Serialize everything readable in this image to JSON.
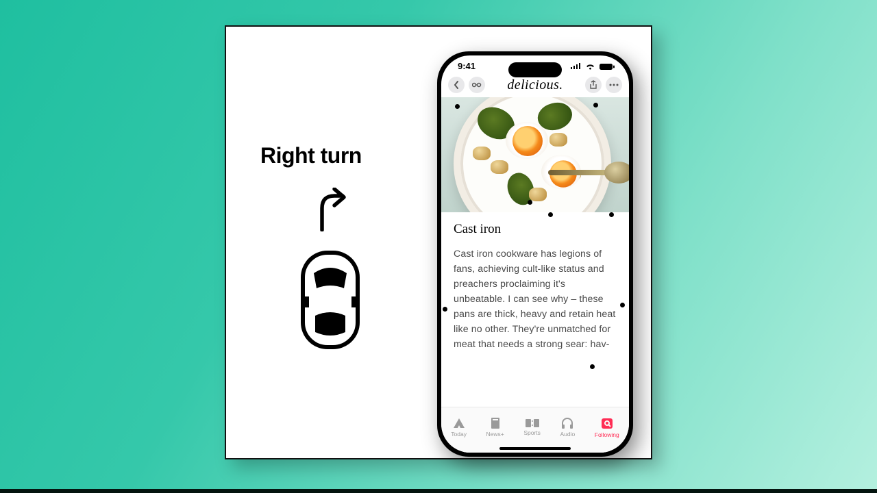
{
  "illustration": {
    "caption": "Right turn",
    "arrow_icon": "right-turn-arrow-icon",
    "car_icon": "car-top-view-icon"
  },
  "phone": {
    "status": {
      "time": "9:41"
    },
    "nav": {
      "back_icon": "chevron-left-icon",
      "reader_icon": "reader-view-icon",
      "brand": "delicious.",
      "share_icon": "share-icon",
      "more_icon": "ellipsis-icon"
    },
    "article": {
      "title": "Cast iron",
      "body": "Cast iron cookware has legions of fans, achieving cult-like status and preachers proclaiming it's unbeatable. I can see why – these pans are thick, heavy and retain heat like no other. They're unmatched for meat that needs a strong sear: hav-"
    },
    "tabs": [
      {
        "label": "Today",
        "icon": "news-today-icon",
        "active": false
      },
      {
        "label": "News+",
        "icon": "news-plus-icon",
        "active": false
      },
      {
        "label": "Sports",
        "icon": "scoreboard-icon",
        "active": false
      },
      {
        "label": "Audio",
        "icon": "headphones-icon",
        "active": false
      },
      {
        "label": "Following",
        "icon": "search-badge-icon",
        "active": true
      }
    ]
  }
}
